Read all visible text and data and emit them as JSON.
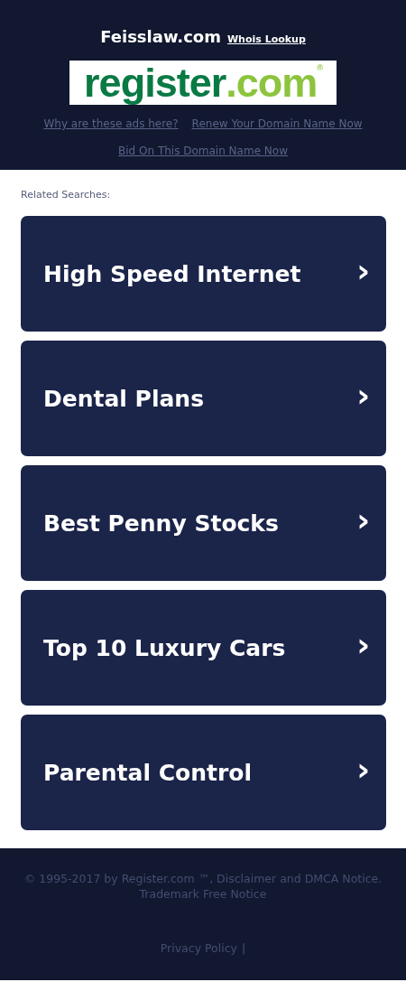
{
  "header": {
    "domain": "Feisslaw.com",
    "whois_link": "Whois Lookup",
    "logo": {
      "name": "register",
      "suffix": ".com",
      "mark": "®"
    },
    "links": [
      "Why are these ads here?",
      "Renew Your Domain Name Now",
      "Bid On This Domain Name Now"
    ]
  },
  "related": {
    "heading": "Related Searches:",
    "items": [
      {
        "label": "High Speed Internet",
        "chevron": "›"
      },
      {
        "label": "Dental Plans",
        "chevron": "›"
      },
      {
        "label": "Best Penny Stocks",
        "chevron": "›"
      },
      {
        "label": "Top 10 Luxury Cars",
        "chevron": "›"
      },
      {
        "label": "Parental Control",
        "chevron": "›"
      }
    ]
  },
  "footer": {
    "copyright": "© 1995-2017 by Register.com ™, Disclaimer and DMCA Notice.",
    "trademark": "Trademark Free Notice",
    "privacy": "Privacy Policy",
    "separator": "|"
  }
}
